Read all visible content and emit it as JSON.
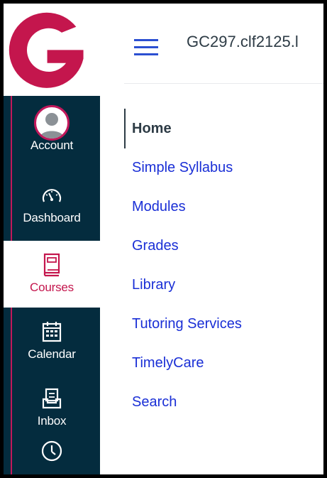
{
  "app": {
    "course_title": "GC297.clf2125.l"
  },
  "global_nav": {
    "logo_letter": "G",
    "items": [
      {
        "label": "Account",
        "icon": "avatar-icon",
        "active": false
      },
      {
        "label": "Dashboard",
        "icon": "dashboard-gauge-icon",
        "active": false
      },
      {
        "label": "Courses",
        "icon": "book-icon",
        "active": true
      },
      {
        "label": "Calendar",
        "icon": "calendar-icon",
        "active": false
      },
      {
        "label": "Inbox",
        "icon": "inbox-icon",
        "active": false
      },
      {
        "label": "",
        "icon": "clock-icon",
        "active": false
      }
    ]
  },
  "course_nav": {
    "items": [
      {
        "label": "Home",
        "active": true
      },
      {
        "label": "Simple Syllabus",
        "active": false
      },
      {
        "label": "Modules",
        "active": false
      },
      {
        "label": "Grades",
        "active": false
      },
      {
        "label": "Library",
        "active": false
      },
      {
        "label": "Tutoring Services",
        "active": false
      },
      {
        "label": "TimelyCare",
        "active": false
      },
      {
        "label": "Search",
        "active": false
      }
    ]
  },
  "colors": {
    "nav_background": "#042C3E",
    "brand_red": "#C4164D",
    "link_blue": "#1A2FD6",
    "text_dark": "#2D3B45"
  }
}
